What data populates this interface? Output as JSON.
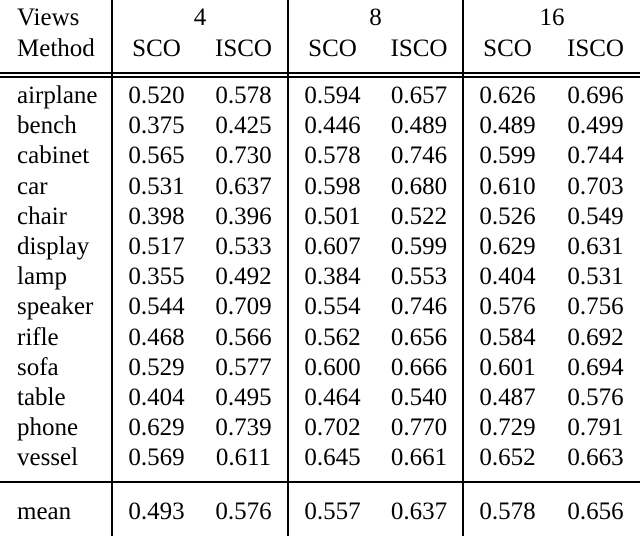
{
  "table": {
    "corner": {
      "views_label": "Views",
      "method_label": "Method"
    },
    "view_groups": [
      {
        "label": "4",
        "sub": [
          "SCO",
          "ISCO"
        ]
      },
      {
        "label": "8",
        "sub": [
          "SCO",
          "ISCO"
        ]
      },
      {
        "label": "16",
        "sub": [
          "SCO",
          "ISCO"
        ]
      }
    ],
    "rows": [
      {
        "label": "airplane",
        "cells": [
          {
            "value": "0.520",
            "bold": false
          },
          {
            "value": "0.578",
            "bold": false
          },
          {
            "value": "0.594",
            "bold": false
          },
          {
            "value": "0.657",
            "bold": false
          },
          {
            "value": "0.626",
            "bold": false
          },
          {
            "value": "0.696",
            "bold": true
          }
        ]
      },
      {
        "label": "bench",
        "cells": [
          {
            "value": "0.375",
            "bold": false
          },
          {
            "value": "0.425",
            "bold": false
          },
          {
            "value": "0.446",
            "bold": false
          },
          {
            "value": "0.489",
            "bold": false
          },
          {
            "value": "0.489",
            "bold": false
          },
          {
            "value": "0.499",
            "bold": true
          }
        ]
      },
      {
        "label": "cabinet",
        "cells": [
          {
            "value": "0.565",
            "bold": false
          },
          {
            "value": "0.730",
            "bold": false
          },
          {
            "value": "0.578",
            "bold": false
          },
          {
            "value": "0.746",
            "bold": true
          },
          {
            "value": "0.599",
            "bold": false
          },
          {
            "value": "0.744",
            "bold": true
          }
        ]
      },
      {
        "label": "car",
        "cells": [
          {
            "value": "0.531",
            "bold": false
          },
          {
            "value": "0.637",
            "bold": false
          },
          {
            "value": "0.598",
            "bold": false
          },
          {
            "value": "0.680",
            "bold": false
          },
          {
            "value": "0.610",
            "bold": false
          },
          {
            "value": "0.703",
            "bold": true
          }
        ]
      },
      {
        "label": "chair",
        "cells": [
          {
            "value": "0.398",
            "bold": false
          },
          {
            "value": "0.396",
            "bold": false
          },
          {
            "value": "0.501",
            "bold": false
          },
          {
            "value": "0.522",
            "bold": false
          },
          {
            "value": "0.526",
            "bold": false
          },
          {
            "value": "0.549",
            "bold": true
          }
        ]
      },
      {
        "label": "display",
        "cells": [
          {
            "value": "0.517",
            "bold": false
          },
          {
            "value": "0.533",
            "bold": false
          },
          {
            "value": "0.607",
            "bold": false
          },
          {
            "value": "0.599",
            "bold": false
          },
          {
            "value": "0.629",
            "bold": false
          },
          {
            "value": "0.631",
            "bold": true
          }
        ]
      },
      {
        "label": "lamp",
        "cells": [
          {
            "value": "0.355",
            "bold": false
          },
          {
            "value": "0.492",
            "bold": false
          },
          {
            "value": "0.384",
            "bold": false
          },
          {
            "value": "0.553",
            "bold": false
          },
          {
            "value": "0.404",
            "bold": false
          },
          {
            "value": "0.531",
            "bold": true
          }
        ]
      },
      {
        "label": "speaker",
        "cells": [
          {
            "value": "0.544",
            "bold": false
          },
          {
            "value": "0.709",
            "bold": false
          },
          {
            "value": "0.554",
            "bold": false
          },
          {
            "value": "0.746",
            "bold": false
          },
          {
            "value": "0.576",
            "bold": false
          },
          {
            "value": "0.756",
            "bold": true
          }
        ]
      },
      {
        "label": "rifle",
        "cells": [
          {
            "value": "0.468",
            "bold": false
          },
          {
            "value": "0.566",
            "bold": false
          },
          {
            "value": "0.562",
            "bold": false
          },
          {
            "value": "0.656",
            "bold": false
          },
          {
            "value": "0.584",
            "bold": false
          },
          {
            "value": "0.692",
            "bold": true
          }
        ]
      },
      {
        "label": "sofa",
        "cells": [
          {
            "value": "0.529",
            "bold": false
          },
          {
            "value": "0.577",
            "bold": false
          },
          {
            "value": "0.600",
            "bold": false
          },
          {
            "value": "0.666",
            "bold": false
          },
          {
            "value": "0.601",
            "bold": false
          },
          {
            "value": "0.694",
            "bold": true
          }
        ]
      },
      {
        "label": "table",
        "cells": [
          {
            "value": "0.404",
            "bold": false
          },
          {
            "value": "0.495",
            "bold": false
          },
          {
            "value": "0.464",
            "bold": false
          },
          {
            "value": "0.540",
            "bold": false
          },
          {
            "value": "0.487",
            "bold": false
          },
          {
            "value": "0.576",
            "bold": true
          }
        ]
      },
      {
        "label": "phone",
        "cells": [
          {
            "value": "0.629",
            "bold": false
          },
          {
            "value": "0.739",
            "bold": false
          },
          {
            "value": "0.702",
            "bold": false
          },
          {
            "value": "0.770",
            "bold": false
          },
          {
            "value": "0.729",
            "bold": false
          },
          {
            "value": "0.791",
            "bold": true
          }
        ]
      },
      {
        "label": "vessel",
        "cells": [
          {
            "value": "0.569",
            "bold": false
          },
          {
            "value": "0.611",
            "bold": false
          },
          {
            "value": "0.645",
            "bold": false
          },
          {
            "value": "0.661",
            "bold": true
          },
          {
            "value": "0.652",
            "bold": false
          },
          {
            "value": "0.663",
            "bold": true
          }
        ]
      }
    ],
    "summary_row": {
      "label": "mean",
      "cells": [
        {
          "value": "0.493",
          "bold": false
        },
        {
          "value": "0.576",
          "bold": false
        },
        {
          "value": "0.557",
          "bold": false
        },
        {
          "value": "0.637",
          "bold": false
        },
        {
          "value": "0.578",
          "bold": false
        },
        {
          "value": "0.656",
          "bold": true
        }
      ]
    }
  }
}
